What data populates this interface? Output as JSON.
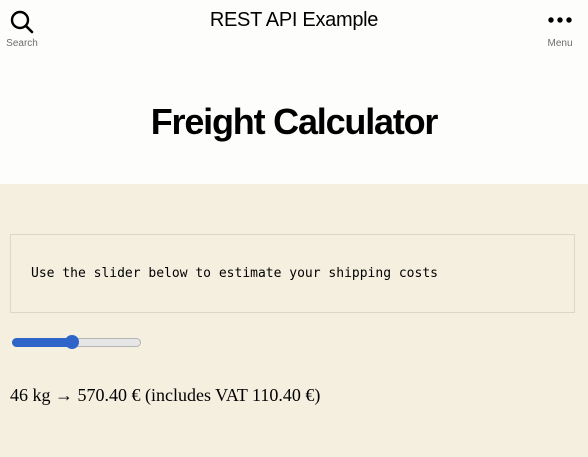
{
  "header": {
    "search_label": "Search",
    "site_title": "REST API Example",
    "menu_label": "Menu"
  },
  "page": {
    "title": "Freight Calculator"
  },
  "calculator": {
    "instructions": "Use the slider below to estimate your shipping costs",
    "slider_fraction": 0.46,
    "result_text": "46 kg → 570.40 € (includes VAT 110.40 €)"
  },
  "colors": {
    "header_bg": "#fdfdfc",
    "content_bg": "#f5efe0",
    "slider_accent": "#2f64c8"
  }
}
